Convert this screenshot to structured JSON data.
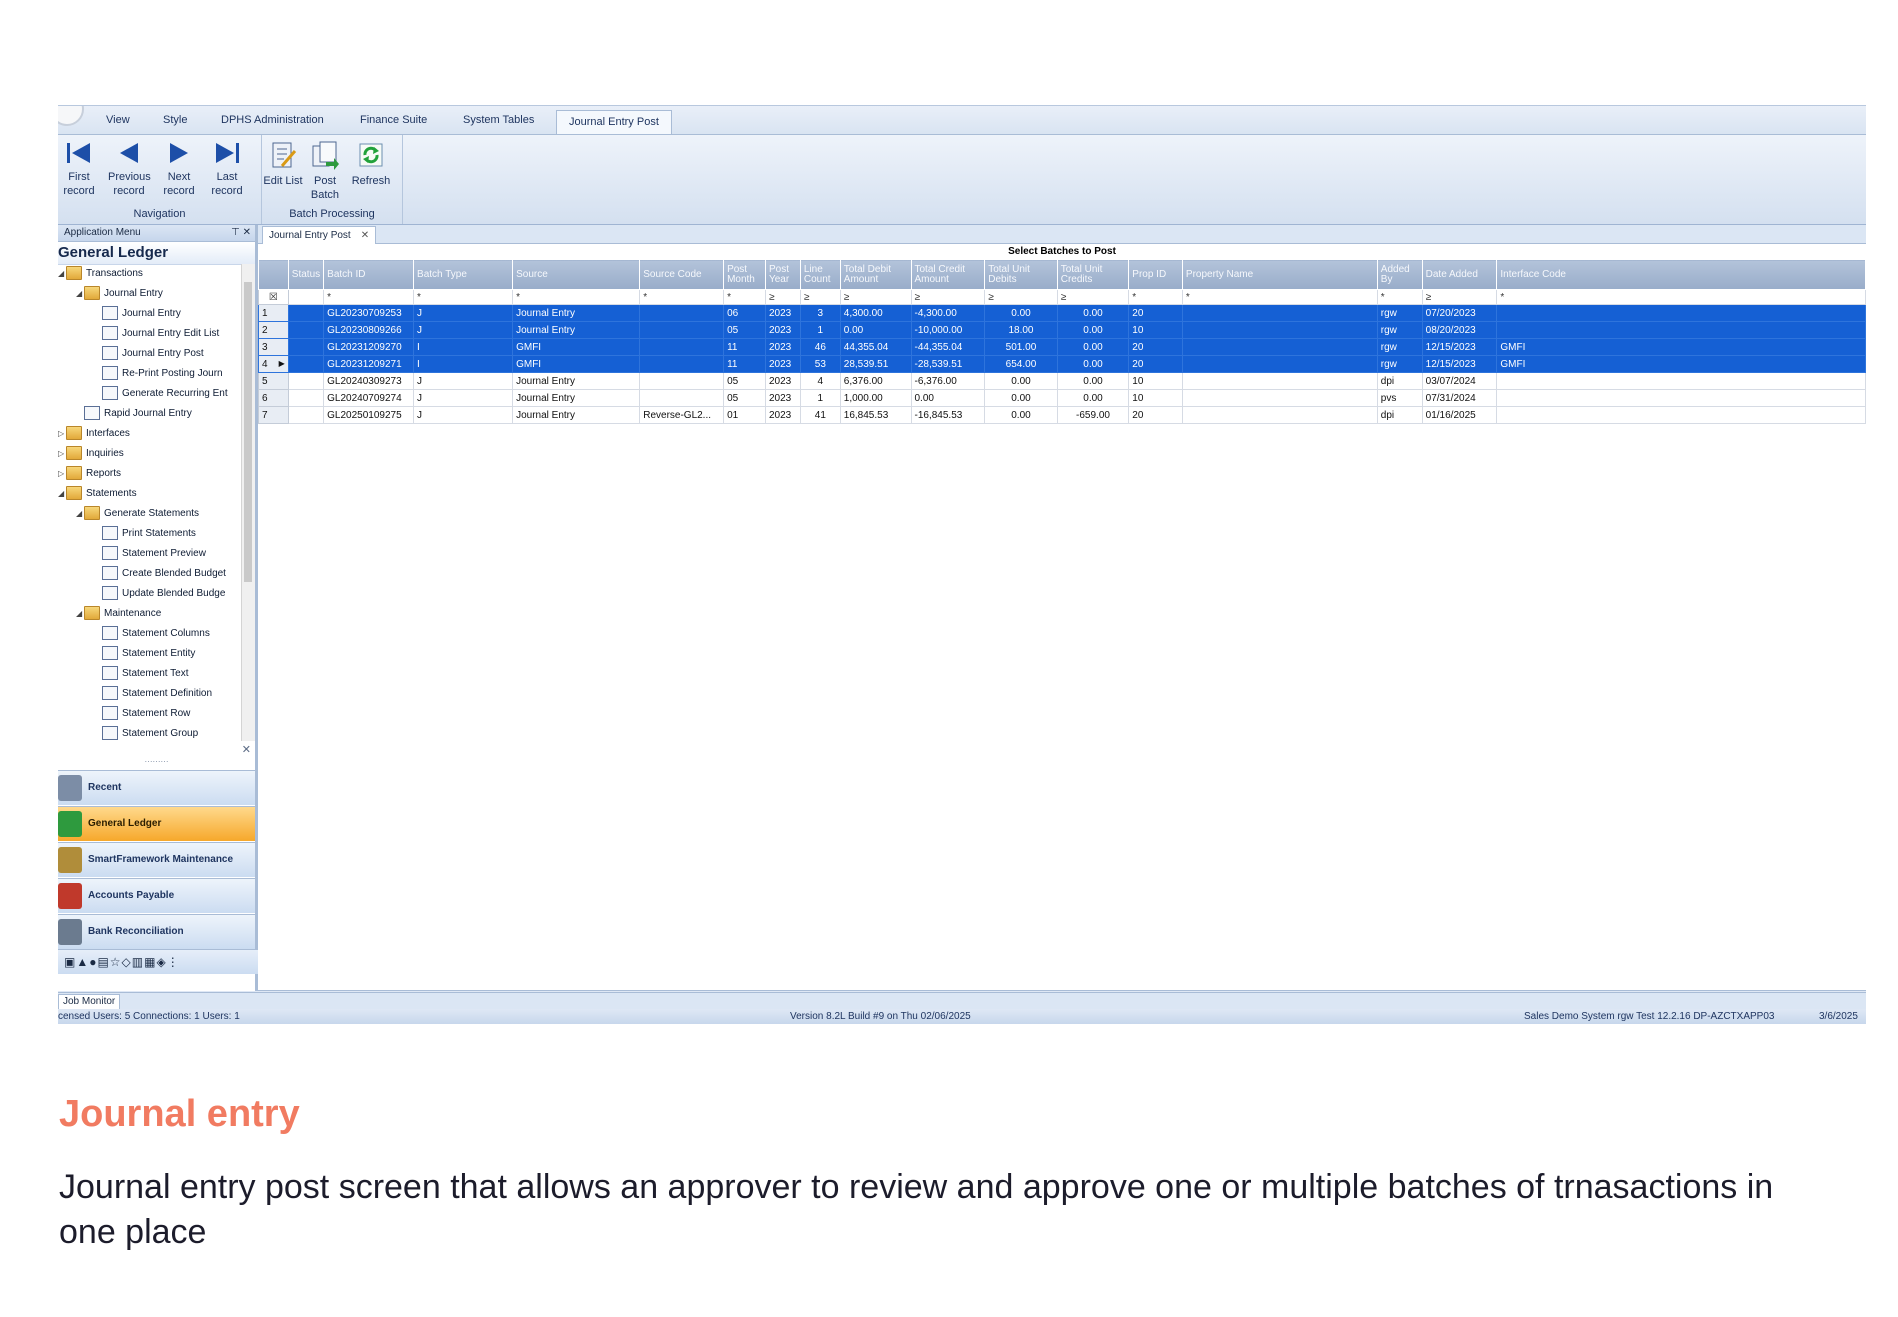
{
  "menu": {
    "tabs": [
      "View",
      "Style",
      "DPHS Administration",
      "Finance Suite",
      "System Tables",
      "Journal Entry Post"
    ],
    "active_tab": "Journal Entry Post"
  },
  "ribbon": {
    "navigation": {
      "group_label": "Navigation",
      "buttons": [
        "First record",
        "Previous record",
        "Next record",
        "Last record"
      ]
    },
    "batch_processing": {
      "group_label": "Batch Processing",
      "buttons": [
        "Edit List",
        "Post Batch",
        "Refresh"
      ]
    }
  },
  "left_panel": {
    "header": "Application Menu",
    "title": "General Ledger",
    "tree": [
      {
        "label": "Transactions",
        "type": "folder",
        "level": 0,
        "expanded": true
      },
      {
        "label": "Journal Entry",
        "type": "folder",
        "level": 1,
        "expanded": true
      },
      {
        "label": "Journal Entry",
        "type": "doc",
        "level": 2
      },
      {
        "label": "Journal Entry Edit List",
        "type": "doc",
        "level": 2
      },
      {
        "label": "Journal Entry Post",
        "type": "doc",
        "level": 2
      },
      {
        "label": "Re-Print Posting Journ",
        "type": "doc",
        "level": 2
      },
      {
        "label": "Generate Recurring Ent",
        "type": "doc",
        "level": 2
      },
      {
        "label": "Rapid Journal Entry",
        "type": "doc",
        "level": 1
      },
      {
        "label": "Interfaces",
        "type": "folder",
        "level": 0,
        "expanded": false
      },
      {
        "label": "Inquiries",
        "type": "folder",
        "level": 0,
        "expanded": false
      },
      {
        "label": "Reports",
        "type": "folder",
        "level": 0,
        "expanded": false
      },
      {
        "label": "Statements",
        "type": "folder",
        "level": 0,
        "expanded": true
      },
      {
        "label": "Generate Statements",
        "type": "folder",
        "level": 1,
        "expanded": true
      },
      {
        "label": "Print Statements",
        "type": "doc",
        "level": 2
      },
      {
        "label": "Statement Preview",
        "type": "doc",
        "level": 2
      },
      {
        "label": "Create Blended Budget",
        "type": "doc",
        "level": 2
      },
      {
        "label": "Update Blended Budge",
        "type": "doc",
        "level": 2
      },
      {
        "label": "Maintenance",
        "type": "folder",
        "level": 1,
        "expanded": true
      },
      {
        "label": "Statement Columns",
        "type": "doc",
        "level": 2
      },
      {
        "label": "Statement Entity",
        "type": "doc",
        "level": 2
      },
      {
        "label": "Statement Text",
        "type": "doc",
        "level": 2
      },
      {
        "label": "Statement Definition",
        "type": "doc",
        "level": 2
      },
      {
        "label": "Statement Row",
        "type": "doc",
        "level": 2
      },
      {
        "label": "Statement Group",
        "type": "doc",
        "level": 2
      }
    ],
    "nav_buttons": [
      {
        "label": "Recent",
        "active": false
      },
      {
        "label": "General Ledger",
        "active": true
      },
      {
        "label": "SmartFramework Maintenance",
        "active": false
      },
      {
        "label": "Accounts Payable",
        "active": false
      },
      {
        "label": "Bank Reconciliation",
        "active": false
      }
    ]
  },
  "document": {
    "tab_label": "Journal Entry Post",
    "grid_title": "Select Batches to Post",
    "columns": [
      "Status",
      "Batch ID",
      "Batch Type",
      "Source",
      "Source Code",
      "Post Month",
      "Post Year",
      "Line Count",
      "Total Debit Amount",
      "Total Credit Amount",
      "Total Unit Debits",
      "Total Unit Credits",
      "Prop ID",
      "Property Name",
      "Added By",
      "Date Added",
      "Interface Code"
    ],
    "filter_row": [
      "",
      "*",
      "*",
      "*",
      "*",
      "*",
      "≥",
      "≥",
      "≥",
      "≥",
      "≥",
      "≥",
      "*",
      "*",
      "*",
      "≥",
      "*"
    ],
    "rows": [
      {
        "n": "1",
        "selected": true,
        "current": false,
        "cells": [
          "",
          "GL20230709253",
          "J",
          "Journal Entry",
          "",
          "06",
          "2023",
          "3",
          "4,300.00",
          "-4,300.00",
          "0.00",
          "0.00",
          "20",
          "",
          "rgw",
          "07/20/2023",
          ""
        ]
      },
      {
        "n": "2",
        "selected": true,
        "current": false,
        "cells": [
          "",
          "GL20230809266",
          "J",
          "Journal Entry",
          "",
          "05",
          "2023",
          "1",
          "0.00",
          "-10,000.00",
          "18.00",
          "0.00",
          "10",
          "",
          "rgw",
          "08/20/2023",
          ""
        ]
      },
      {
        "n": "3",
        "selected": true,
        "current": false,
        "cells": [
          "",
          "GL20231209270",
          "I",
          "GMFI",
          "",
          "11",
          "2023",
          "46",
          "44,355.04",
          "-44,355.04",
          "501.00",
          "0.00",
          "20",
          "",
          "rgw",
          "12/15/2023",
          "GMFI"
        ]
      },
      {
        "n": "4",
        "selected": true,
        "current": true,
        "cells": [
          "",
          "GL20231209271",
          "I",
          "GMFI",
          "",
          "11",
          "2023",
          "53",
          "28,539.51",
          "-28,539.51",
          "654.00",
          "0.00",
          "20",
          "",
          "rgw",
          "12/15/2023",
          "GMFI"
        ]
      },
      {
        "n": "5",
        "selected": false,
        "current": false,
        "cells": [
          "",
          "GL20240309273",
          "J",
          "Journal Entry",
          "",
          "05",
          "2023",
          "4",
          "6,376.00",
          "-6,376.00",
          "0.00",
          "0.00",
          "10",
          "",
          "dpi",
          "03/07/2024",
          ""
        ]
      },
      {
        "n": "6",
        "selected": false,
        "current": false,
        "cells": [
          "",
          "GL20240709274",
          "J",
          "Journal Entry",
          "",
          "05",
          "2023",
          "1",
          "1,000.00",
          "0.00",
          "0.00",
          "0.00",
          "10",
          "",
          "pvs",
          "07/31/2024",
          ""
        ]
      },
      {
        "n": "7",
        "selected": false,
        "current": false,
        "cells": [
          "",
          "GL20250109275",
          "J",
          "Journal Entry",
          "Reverse-GL2...",
          "01",
          "2023",
          "41",
          "16,845.53",
          "-16,845.53",
          "0.00",
          "-659.00",
          "20",
          "",
          "dpi",
          "01/16/2025",
          ""
        ]
      }
    ]
  },
  "job_monitor": "Job Monitor",
  "status_bar": {
    "left": "censed Users: 5 Connections: 1 Users: 1",
    "center": "Version 8.2L Build #9 on Thu 02/06/2025",
    "right": "Sales Demo System  rgw  Test  12.2.16  DP-AZCTXAPP03",
    "date": "3/6/2025"
  },
  "caption": {
    "title": "Journal entry",
    "body": "Journal entry post screen that allows an approver to review and approve one or multiple batches of trnasactions in one place"
  },
  "colors": {
    "selection": "#1560d4",
    "accent": "#f17b61",
    "nav_active": "#f6a82b",
    "header": "#a9bcd6"
  }
}
